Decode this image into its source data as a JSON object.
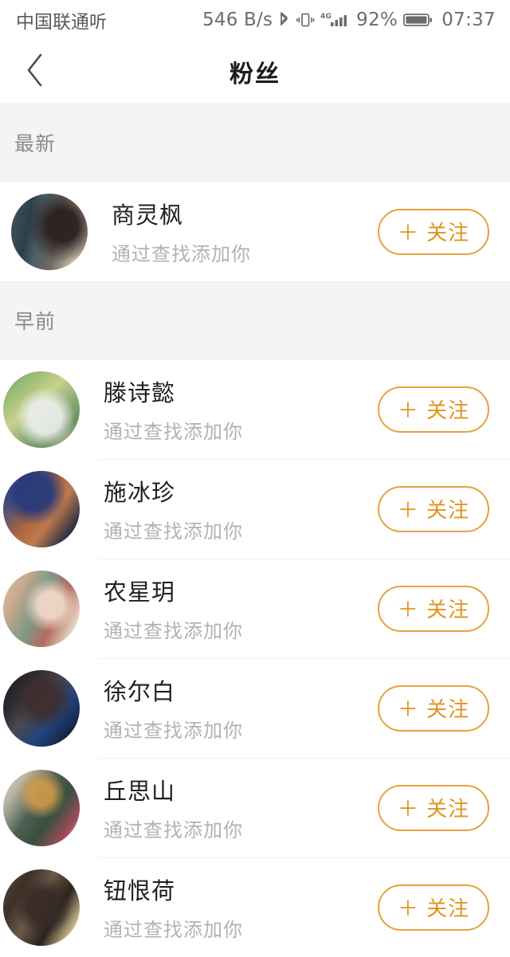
{
  "status_bar": {
    "carrier": "中国联通",
    "carrier_suffix": "听",
    "net_speed": "546 B/s",
    "bluetooth_icon": "bluetooth-icon",
    "vibrate_icon": "vibrate-icon",
    "signal_icon": "signal-4g-icon",
    "network_type": "4G",
    "battery_percent": "92%",
    "battery_icon": "battery-icon",
    "time": "07:37"
  },
  "nav": {
    "back_icon": "chevron-left-icon",
    "title": "粉丝"
  },
  "sections": [
    {
      "header": "最新",
      "items": [
        {
          "name": "商灵枫",
          "subtitle": "通过查找添加你",
          "action": "＋ 关注",
          "avatar": "av1"
        }
      ]
    },
    {
      "header": "早前",
      "items": [
        {
          "name": "滕诗懿",
          "subtitle": "通过查找添加你",
          "action": "＋ 关注",
          "avatar": "av2"
        },
        {
          "name": "施冰珍",
          "subtitle": "通过查找添加你",
          "action": "＋ 关注",
          "avatar": "av3"
        },
        {
          "name": "农星玥",
          "subtitle": "通过查找添加你",
          "action": "＋ 关注",
          "avatar": "av4"
        },
        {
          "name": "徐尔白",
          "subtitle": "通过查找添加你",
          "action": "＋ 关注",
          "avatar": "av5"
        },
        {
          "name": "丘思山",
          "subtitle": "通过查找添加你",
          "action": "＋ 关注",
          "avatar": "av6"
        },
        {
          "name": "钮恨荷",
          "subtitle": "通过查找添加你",
          "action": "＋ 关注",
          "avatar": "av7"
        }
      ]
    }
  ],
  "colors": {
    "accent": "#e5a23c",
    "accent_text": "#e0931f",
    "section_bg": "#f4f4f4",
    "name_text": "#1f1f1f",
    "sub_text": "#b2b2b2"
  }
}
